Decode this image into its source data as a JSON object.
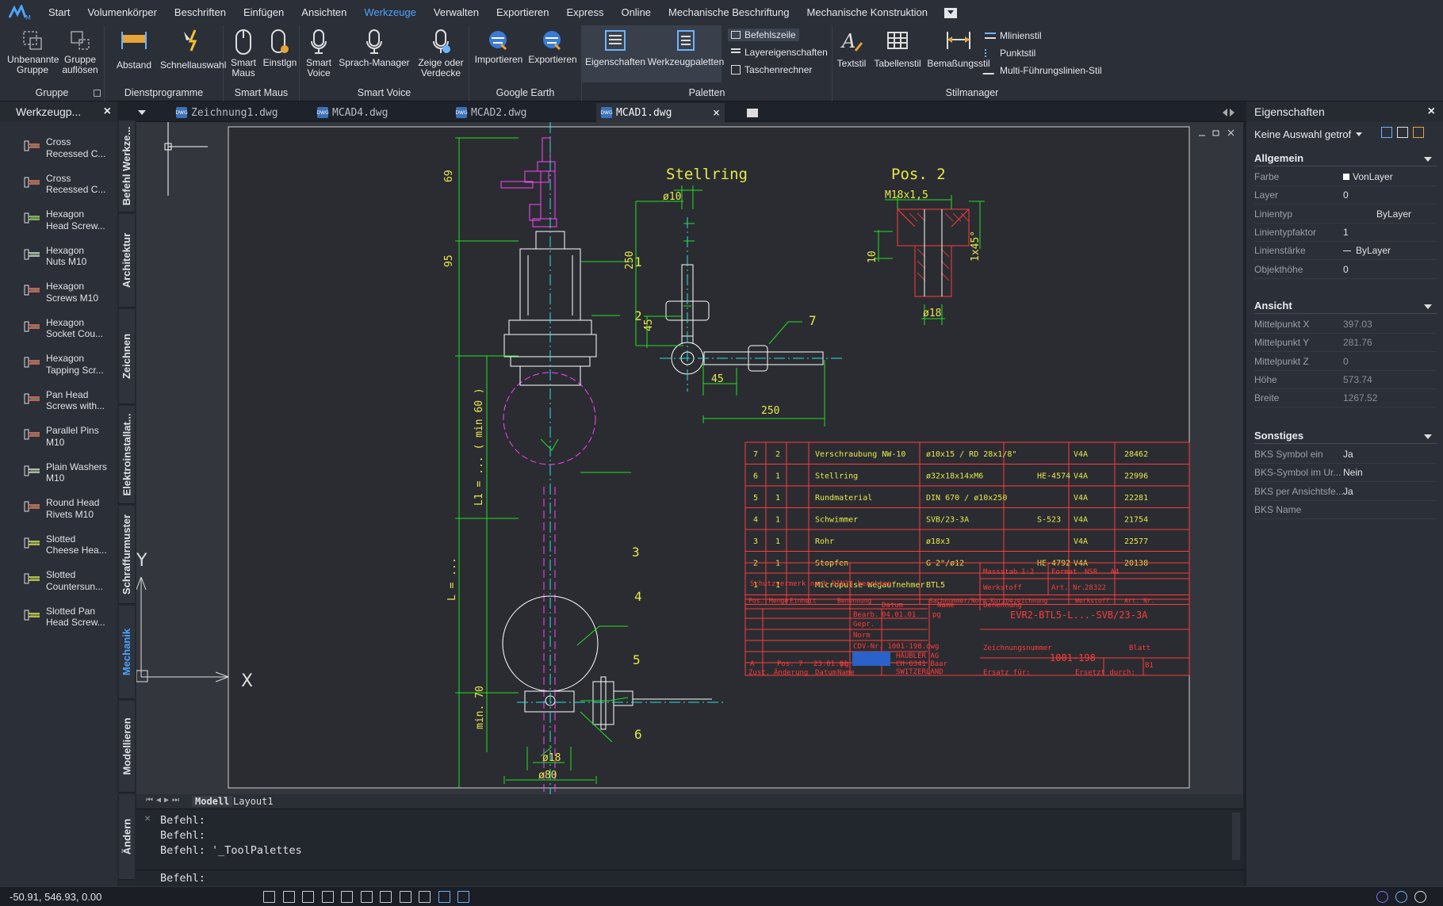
{
  "menu": {
    "items": [
      "Start",
      "Volumenkörper",
      "Beschriften",
      "Einfügen",
      "Ansichten",
      "Werkzeuge",
      "Verwalten",
      "Exportieren",
      "Express",
      "Online",
      "Mechanische Beschriftung",
      "Mechanische Konstruktion"
    ],
    "active": "Werkzeuge"
  },
  "ribbon": {
    "groups": {
      "gruppe": {
        "title": "Gruppe",
        "buttons": [
          "Unbenannte Gruppe",
          "Gruppe auflösen"
        ]
      },
      "dienst": {
        "title": "Dienstprogramme",
        "buttons": [
          "Abstand",
          "Schnellauswahl"
        ]
      },
      "smartmaus": {
        "title": "Smart Maus",
        "buttons": [
          "Smart Maus",
          "Einstlgn"
        ]
      },
      "smartvoice": {
        "title": "Smart Voice",
        "buttons": [
          "Smart Voice",
          "Sprach-Manager",
          "Zeige oder Verdecke"
        ]
      },
      "earth": {
        "title": "Google Earth",
        "buttons": [
          "Importieren",
          "Exportieren"
        ]
      },
      "paletten": {
        "title": "Paletten",
        "buttons": [
          "Eigenschaften",
          "Werkzeugpaletten"
        ],
        "small": [
          "Befehlszeile",
          "Layereigenschaften",
          "Taschenrechner"
        ]
      },
      "stil": {
        "title": "Stilmanager",
        "buttons": [
          "Textstil",
          "Tabellenstil",
          "Bemaßungsstil"
        ],
        "small": [
          "Mlinienstil",
          "Punktstil",
          "Multi-Führungslinien-Stil"
        ]
      }
    }
  },
  "toolpalette": {
    "title": "Werkzeugp...",
    "tools": [
      [
        "Cross",
        "Recessed C..."
      ],
      [
        "Cross",
        "Recessed C..."
      ],
      [
        "Hexagon",
        "Head Screw..."
      ],
      [
        "Hexagon",
        "Nuts M10"
      ],
      [
        "Hexagon",
        "Screws M10"
      ],
      [
        "Hexagon",
        "Socket Cou..."
      ],
      [
        "Hexagon",
        "Tapping Scr..."
      ],
      [
        "Pan Head",
        "Screws with..."
      ],
      [
        "Parallel Pins",
        "M10"
      ],
      [
        "Plain Washers",
        "M10"
      ],
      [
        "Round Head",
        "Rivets M10"
      ],
      [
        "Slotted",
        "Cheese Hea..."
      ],
      [
        "Slotted",
        "Countersun..."
      ],
      [
        "Slotted Pan",
        "Head Screw..."
      ]
    ],
    "vtabs": [
      "Befehl Werkze...",
      "Architektur",
      "Zeichnen",
      "Elektroinstallat...",
      "Schraffurmuster",
      "Mechanik",
      "Modellieren",
      "Ändern"
    ],
    "active_vtab": "Mechanik"
  },
  "doctabs": [
    "Zeichnung1.dwg",
    "MCAD4.dwg",
    "MCAD2.dwg",
    "MCAD1.dwg"
  ],
  "active_doc": "MCAD1.dwg",
  "layout_tabs": [
    "Modell",
    "Layout1"
  ],
  "drawing": {
    "titles": [
      "Stellring",
      "Pos. 2"
    ],
    "dims_main": [
      "69",
      "95",
      "L1 = ... ( min 60 )",
      "L = ...",
      "min. 70",
      "ø18",
      "ø80"
    ],
    "labels": [
      "1",
      "2",
      "3",
      "4",
      "5",
      "6",
      "7"
    ],
    "dims_stellring": [
      "ø10",
      "250",
      "45",
      "45",
      "250"
    ],
    "dims_pos2": [
      "M18x1,5",
      "10",
      "1x45°",
      "ø18"
    ],
    "parts": [
      [
        "7",
        "2",
        "Verschraubung NW-10",
        "ø10x15 / RD 28x1/8\"",
        "",
        "V4A",
        "28462"
      ],
      [
        "6",
        "1",
        "Stellring",
        "ø32x18x14xM6",
        "HE-4574",
        "V4A",
        "22996"
      ],
      [
        "5",
        "1",
        "Rundmaterial",
        "DIN 670 / ø10x250",
        "",
        "V4A",
        "22281"
      ],
      [
        "4",
        "1",
        "Schwimmer",
        "SVB/23-3A",
        "S-523",
        "V4A",
        "21754"
      ],
      [
        "3",
        "1",
        "Rohr",
        "ø18x3",
        "",
        "V4A",
        "22577"
      ],
      [
        "2",
        "1",
        "Stopfen",
        "G 2\"/ø12",
        "HE-4792",
        "V4A",
        "20138"
      ],
      [
        "1",
        "1",
        "Micropulse Wegaufnehmer",
        "BTL5",
        "",
        "",
        ""
      ]
    ],
    "title_block": {
      "header": [
        "Pos.",
        "Menge",
        "Einheit",
        "Benennung",
        "Sachnummer/Norm-Kurzbezeichnung",
        "Werkstoff",
        "Art. Nr."
      ],
      "schutz": "Schutzvermerk nach DIN34 beachten",
      "massstab": "Massstab",
      "massstab_val": "1:2",
      "format": "Format",
      "format_val": "NSR...A4",
      "werkstoff": "Werkstoff",
      "artnr": "Art. Nr.",
      "artnr_val": "28322",
      "benennung_label": "Benennung",
      "benennung": "EVR2-BTL5-L...-SVB/23-3A",
      "datum": "Datum",
      "name": "Name",
      "bearb": "Bearb.",
      "gepr": "Gepr.",
      "norm": "Norm",
      "bearb_date": "04.01.01",
      "bearb_name": "pg",
      "cdv": "CDV-Nr. 1001-198.dwg",
      "company": [
        "HÄUBLER AG",
        "CH-6341 Baar",
        "SWITZERLAND"
      ],
      "zeichnungsnr_label": "Zeichnungsnummer",
      "zeichnungsnr": "1001-198",
      "blatt": "Blatt",
      "blatt_val": "B1",
      "rev": [
        "A",
        "Pos. 7",
        "23.01.01",
        "pg"
      ],
      "footer": [
        "Zust.",
        "Änderung",
        "Datum",
        "Name",
        "Ersatz für:",
        "Ersetzt durch:"
      ]
    }
  },
  "command": {
    "lines": [
      "Befehl:",
      "Befehl:",
      "Befehl: '_ToolPalettes"
    ],
    "prompt": "Befehl:"
  },
  "properties": {
    "title": "Eigenschaften",
    "selection": "Keine Auswahl getrof",
    "sections": {
      "allgemein": {
        "title": "Allgemein",
        "rows": [
          [
            "Farbe",
            "VonLayer"
          ],
          [
            "Layer",
            "0"
          ],
          [
            "Linientyp",
            "ByLayer"
          ],
          [
            "Linientypfaktor",
            "1"
          ],
          [
            "Linienstärke",
            "ByLayer"
          ],
          [
            "Objekthöhe",
            "0"
          ]
        ]
      },
      "ansicht": {
        "title": "Ansicht",
        "rows": [
          [
            "Mittelpunkt X",
            "397.03"
          ],
          [
            "Mittelpunkt Y",
            "281.76"
          ],
          [
            "Mittelpunkt Z",
            "0"
          ],
          [
            "Höhe",
            "573.74"
          ],
          [
            "Breite",
            "1267.52"
          ]
        ]
      },
      "sonstiges": {
        "title": "Sonstiges",
        "rows": [
          [
            "BKS Symbol ein",
            "Ja"
          ],
          [
            "BKS-Symbol im Ur...",
            "Nein"
          ],
          [
            "BKS per Ansichtsfe...",
            "Ja"
          ],
          [
            "BKS Name",
            ""
          ]
        ]
      }
    }
  },
  "status": {
    "coords": "-50.91, 546.93, 0.00"
  },
  "axes": {
    "x": "X",
    "y": "Y"
  },
  "colors": {
    "accent": "#4fa3ff",
    "green": "#22e022",
    "yellow": "#e8e84a",
    "magenta": "#ff44ff",
    "red": "#ff3b3b",
    "cyan": "#2ee0e0",
    "white": "#ffffff"
  }
}
